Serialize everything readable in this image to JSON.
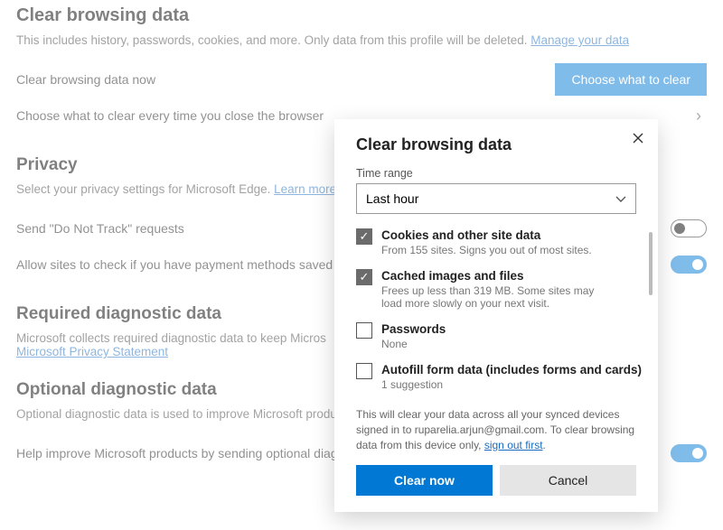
{
  "page": {
    "title": "Clear browsing data",
    "subtitle": "This includes history, passwords, cookies, and more. Only data from this profile will be deleted. ",
    "manage_link": "Manage your data",
    "clear_now_label": "Clear browsing data now",
    "choose_btn": "Choose what to clear",
    "on_close_label": "Choose what to clear every time you close the browser",
    "privacy_title": "Privacy",
    "privacy_sub": "Select your privacy settings for Microsoft Edge. ",
    "learn_more": "Learn more a",
    "dnt_label": "Send \"Do Not Track\" requests",
    "payment_label": "Allow sites to check if you have payment methods saved",
    "diag_title": "Required diagnostic data",
    "diag_sub": "Microsoft collects required diagnostic data to keep Micros",
    "privacy_stmt": "Microsoft Privacy Statement",
    "opt_diag_title": "Optional diagnostic data",
    "opt_diag_sub": "Optional diagnostic data is used to improve Microsoft produ",
    "help_improve": "Help improve Microsoft products by sending optional diag"
  },
  "dialog": {
    "title": "Clear browsing data",
    "time_label": "Time range",
    "time_value": "Last hour",
    "items": [
      {
        "checked": true,
        "title": "Cookies and other site data",
        "sub": "From 155 sites. Signs you out of most sites."
      },
      {
        "checked": true,
        "title": "Cached images and files",
        "sub": "Frees up less than 319 MB. Some sites may load more slowly on your next visit."
      },
      {
        "checked": false,
        "title": "Passwords",
        "sub": "None"
      },
      {
        "checked": false,
        "title": "Autofill form data (includes forms and cards)",
        "sub": "1 suggestion"
      }
    ],
    "sync_note_a": "This will clear your data across all your synced devices signed in to ruparelia.arjun@gmail.com. To clear browsing data from this device only, ",
    "sync_link": "sign out first",
    "clear_btn": "Clear now",
    "cancel_btn": "Cancel"
  }
}
